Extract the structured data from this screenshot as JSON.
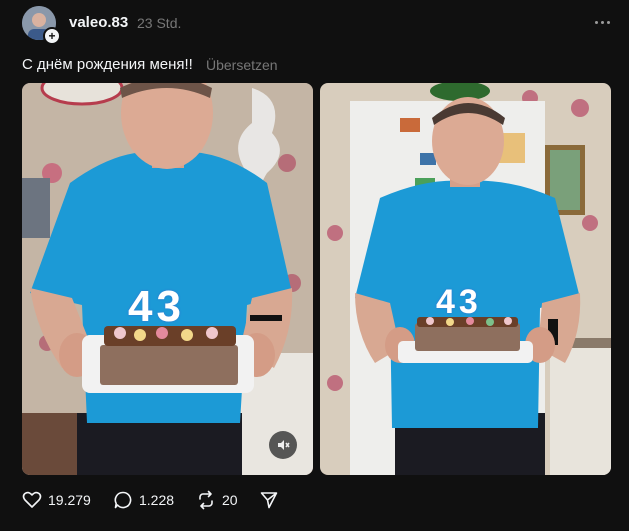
{
  "post": {
    "username": "valeo.83",
    "timestamp": "23 Std.",
    "caption": "С днём рождения меня!!",
    "translate_label": "Übersetzen",
    "follow_symbol": "+",
    "candle_number": "43"
  },
  "actions": {
    "likes": "19.279",
    "replies": "1.228",
    "reposts": "20"
  },
  "icons": {
    "like": "heart-icon",
    "reply": "comment-icon",
    "repost": "repost-icon",
    "share": "send-icon",
    "more": "more-icon",
    "mute": "mute-icon"
  },
  "colors": {
    "background": "#101010",
    "text": "#f3f5f7",
    "muted_text": "#777777",
    "shirt": "#1c9ad6"
  }
}
